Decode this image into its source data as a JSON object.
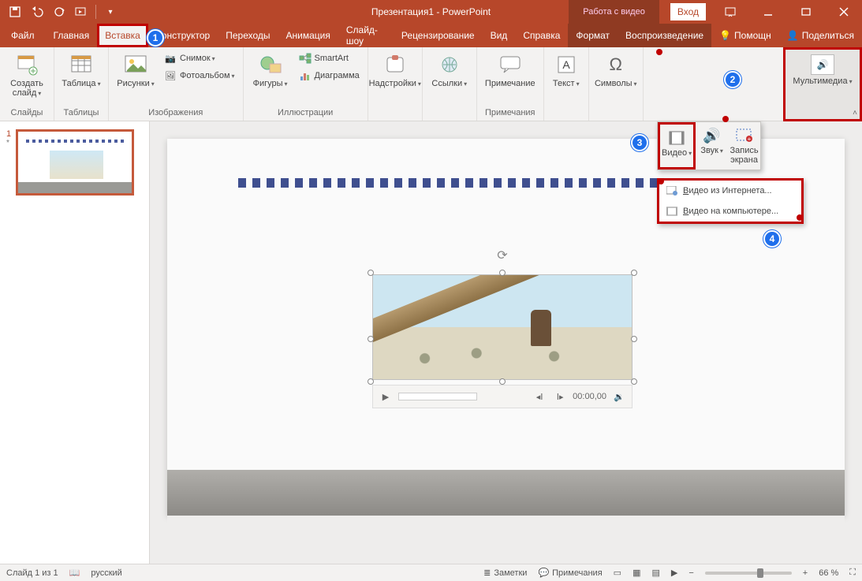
{
  "titlebar": {
    "title": "Презентация1 - PowerPoint",
    "video_tools": "Работа с видео",
    "login": "Вход"
  },
  "tabs": {
    "file": "Файл",
    "home": "Главная",
    "insert": "Вставка",
    "design": "Конструктор",
    "transitions": "Переходы",
    "animation": "Анимация",
    "slideshow": "Слайд-шоу",
    "review": "Рецензирование",
    "view": "Вид",
    "help": "Справка",
    "format": "Формат",
    "playback": "Воспроизведение",
    "tell_me": "Помощн",
    "share": "Поделиться"
  },
  "ribbon": {
    "slides": {
      "new_slide": "Создать\nслайд",
      "group": "Слайды"
    },
    "tables": {
      "table": "Таблица",
      "group": "Таблицы"
    },
    "images": {
      "pictures": "Рисунки",
      "screenshot": "Снимок",
      "album": "Фотоальбом",
      "group": "Изображения"
    },
    "illustrations": {
      "shapes": "Фигуры",
      "smartart": "SmartArt",
      "chart": "Диаграмма",
      "group": "Иллюстрации"
    },
    "addins": {
      "addins": "Надстройки",
      "group": ""
    },
    "links": {
      "links": "Ссылки",
      "group": ""
    },
    "comments": {
      "comment": "Примечание",
      "group": "Примечания"
    },
    "text": {
      "text": "Текст",
      "group": ""
    },
    "symbols": {
      "symbols": "Символы",
      "group": ""
    },
    "media": {
      "media": "Мультимедиа",
      "group": ""
    }
  },
  "media_dropdown": {
    "video": "Видео",
    "audio": "Звук",
    "screenrec": "Запись\nэкрана",
    "online_prefix": "В",
    "online_rest": "идео из Интернета...",
    "file_prefix": "В",
    "file_rest": "идео на компьютере..."
  },
  "markers": {
    "m1": "1",
    "m2": "2",
    "m3": "3",
    "m4": "4"
  },
  "thumb": {
    "num": "1",
    "star": "*"
  },
  "player": {
    "time": "00:00,00"
  },
  "status": {
    "slide_of": "Слайд 1 из 1",
    "lang": "русский",
    "notes": "Заметки",
    "comments": "Примечания",
    "zoom": "66 %"
  }
}
